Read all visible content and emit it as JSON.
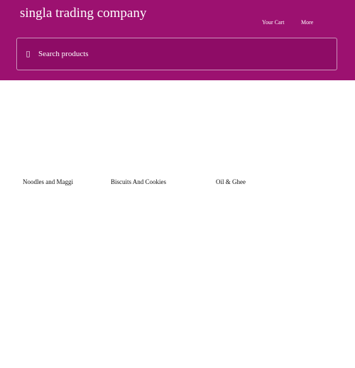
{
  "header": {
    "app_title": "singla trading company",
    "nav": {
      "cart_label": "Your Cart",
      "more_label": "More"
    },
    "background_color": "#9c1170"
  },
  "search": {
    "placeholder": "Search products",
    "value": "",
    "icon": "search-icon"
  },
  "categories": [
    {
      "label": "Noodles and Maggi"
    },
    {
      "label": "Biscuits And Cookies"
    },
    {
      "label": "Oil & Ghee"
    }
  ]
}
